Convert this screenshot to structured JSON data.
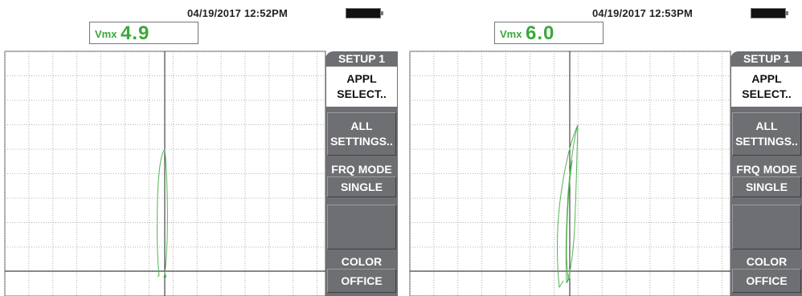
{
  "screens": [
    {
      "datetime": "04/19/2017   12:52PM",
      "vmx_label": "Vmx",
      "vmx_value": "4.9",
      "menu": {
        "title": "SETUP 1",
        "appl_line1": "APPL",
        "appl_line2": "SELECT..",
        "all_line1": "ALL",
        "all_line2": "SETTINGS..",
        "frq_label": "FRQ MODE",
        "frq_value": "SINGLE",
        "color_label": "COLOR",
        "color_value": "OFFICE"
      }
    },
    {
      "datetime": "04/19/2017   12:53PM",
      "vmx_label": "Vmx",
      "vmx_value": "6.0",
      "menu": {
        "title": "SETUP 1",
        "appl_line1": "APPL",
        "appl_line2": "SELECT..",
        "all_line1": "ALL",
        "all_line2": "SETTINGS..",
        "frq_label": "FRQ MODE",
        "frq_value": "SINGLE",
        "color_label": "COLOR",
        "color_value": "OFFICE"
      }
    }
  ],
  "colors": {
    "signal": "#55b355",
    "menu_gray": "#6d6f72",
    "vmx_green": "#3aa83a",
    "grid_dot": "#9a9a9a"
  },
  "battery_icon": "battery-full-icon"
}
